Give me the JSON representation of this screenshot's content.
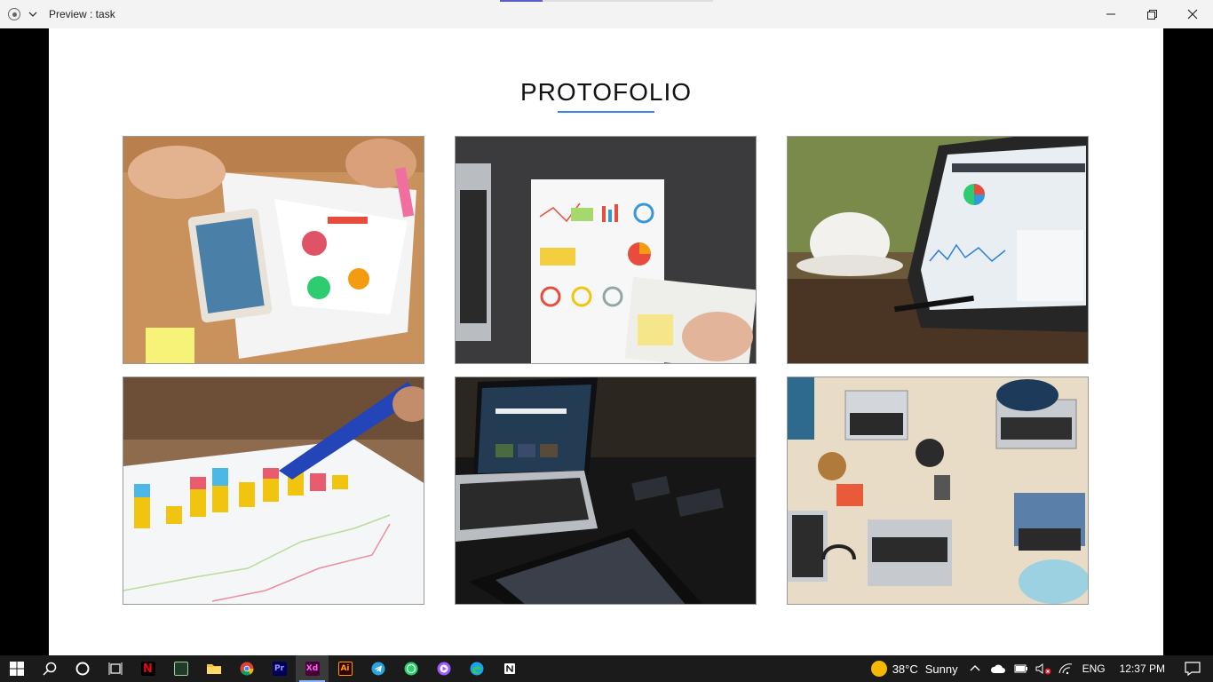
{
  "window": {
    "title": "Preview : task",
    "minimize_icon": "minimize-icon",
    "restore_icon": "restore-icon",
    "close_icon": "close-icon",
    "progress_fraction": 0.2
  },
  "page": {
    "heading": "PROTOFOLIO",
    "accent": "#3b82f6",
    "portfolio_items": [
      {
        "subject": "tablet-and-charts-on-desk"
      },
      {
        "subject": "laptop-with-report-and-notebook"
      },
      {
        "subject": "tablet-dashboard-with-coffee"
      },
      {
        "subject": "pen-on-bar-chart"
      },
      {
        "subject": "laptop-and-devices-dark"
      },
      {
        "subject": "team-laptops-top-view"
      }
    ]
  },
  "taskbar": {
    "apps": [
      "windows-start",
      "search",
      "cortana",
      "task-view",
      "netflix",
      "app-green",
      "file-explorer",
      "chrome",
      "premiere",
      "adobe-xd",
      "illustrator",
      "telegram",
      "whatsapp",
      "media-player",
      "edge",
      "notion"
    ],
    "xd_label": "Xd",
    "pr_label": "Pr",
    "ai_label": "Ai",
    "netflix_label": "N",
    "weather_temp": "38°C",
    "weather_desc": "Sunny",
    "language": "ENG",
    "time": "12:37 PM"
  }
}
